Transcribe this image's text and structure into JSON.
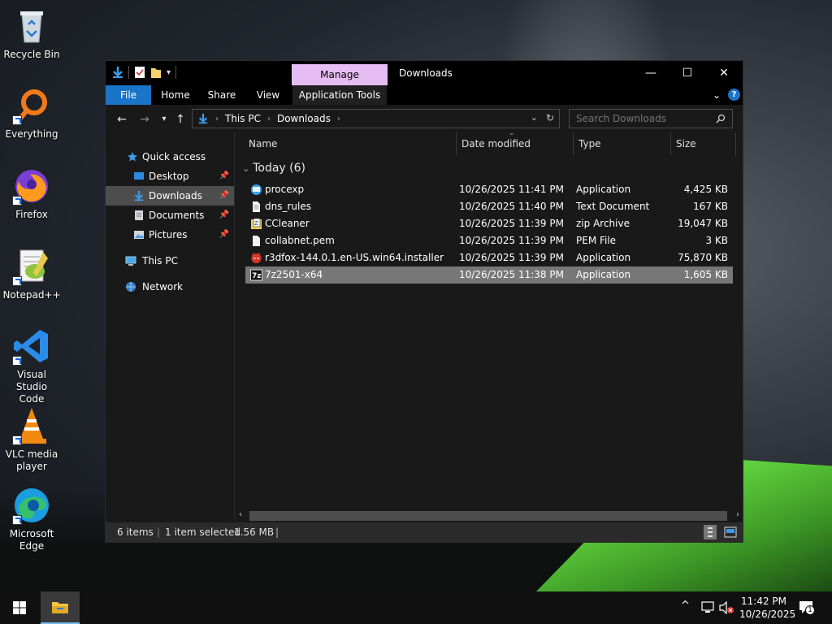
{
  "desktop": {
    "icons": [
      {
        "label_1": "Recycle Bin",
        "label_2": ""
      },
      {
        "label_1": "Everything",
        "label_2": ""
      },
      {
        "label_1": "Firefox",
        "label_2": ""
      },
      {
        "label_1": "Notepad++",
        "label_2": ""
      },
      {
        "label_1": "Visual Studio",
        "label_2": "Code"
      },
      {
        "label_1": "VLC media",
        "label_2": "player"
      },
      {
        "label_1": "Microsoft",
        "label_2": "Edge"
      }
    ]
  },
  "window": {
    "title": "Downloads",
    "contextual_tab": "Manage",
    "ribbon_tabs": [
      "File",
      "Home",
      "Share",
      "View",
      "Application Tools"
    ],
    "controls": {
      "minimize": "—",
      "maximize": "☐",
      "close": "✕"
    }
  },
  "address": {
    "segments": [
      "This PC",
      "Downloads"
    ],
    "search_placeholder": "Search Downloads"
  },
  "nav_pane": {
    "quick_access": "Quick access",
    "pinned": [
      "Desktop",
      "Downloads",
      "Documents",
      "Pictures"
    ],
    "this_pc": "This PC",
    "network": "Network"
  },
  "columns": {
    "name": "Name",
    "date": "Date modified",
    "type": "Type",
    "size": "Size"
  },
  "group": {
    "label": "Today (6)"
  },
  "files": [
    {
      "name": "procexp",
      "date": "10/26/2025 11:41 PM",
      "type": "Application",
      "size": "4,425 KB",
      "icon": "procexp-icon"
    },
    {
      "name": "dns_rules",
      "date": "10/26/2025 11:40 PM",
      "type": "Text Document",
      "size": "167 KB",
      "icon": "text-file-icon"
    },
    {
      "name": "CCleaner",
      "date": "10/26/2025 11:39 PM",
      "type": "zip Archive",
      "size": "19,047 KB",
      "icon": "zip-icon"
    },
    {
      "name": "collabnet.pem",
      "date": "10/26/2025 11:39 PM",
      "type": "PEM File",
      "size": "3 KB",
      "icon": "pem-file-icon"
    },
    {
      "name": "r3dfox-144.0.1.en-US.win64.installer",
      "date": "10/26/2025 11:39 PM",
      "type": "Application",
      "size": "75,870 KB",
      "icon": "r3dfox-icon"
    },
    {
      "name": "7z2501-x64",
      "date": "10/26/2025 11:38 PM",
      "type": "Application",
      "size": "1,605 KB",
      "icon": "7zip-icon"
    }
  ],
  "status": {
    "items": "6 items",
    "selected": "1 item selected",
    "selected_size": "1.56 MB",
    "separator": "|"
  },
  "taskbar": {
    "time": "11:42 PM",
    "date": "10/26/2025",
    "notification_count": "1"
  },
  "colors": {
    "accent": "#1a74c7",
    "manage_tab": "#e6bdf2",
    "selection": "#777777"
  }
}
